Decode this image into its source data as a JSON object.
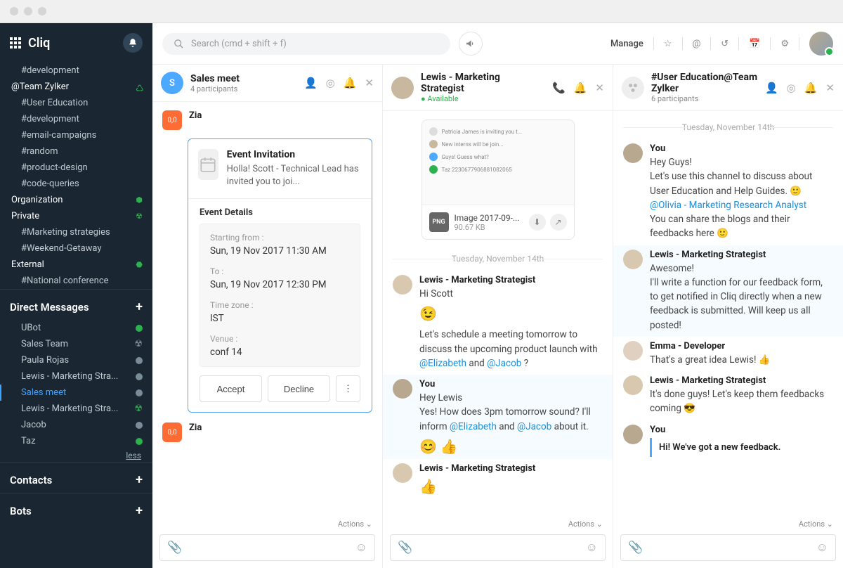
{
  "app": {
    "name": "Cliq"
  },
  "topbar": {
    "search_placeholder": "Search (cmd + shift + f)",
    "manage": "Manage"
  },
  "sidebar": {
    "channels_top": [
      "#development"
    ],
    "team": "@Team Zylker",
    "team_channels": [
      "#User Education",
      "#development",
      "#email-campaigns",
      "#random",
      "#product-design",
      "#code-queries"
    ],
    "org": "Organization",
    "private": "Private",
    "private_channels": [
      "#Marketing strategies",
      "#Weekend-Getaway"
    ],
    "external": "External",
    "external_channels": [
      "#National conference"
    ],
    "dm_header": "Direct Messages",
    "dms": [
      "UBot",
      "Sales Team",
      "Paula Rojas",
      "Lewis - Marketing Stra...",
      "Sales meet",
      "Lewis - Marketing Stra...",
      "Jacob",
      "Taz"
    ],
    "less": "less",
    "contacts_header": "Contacts",
    "bots_header": "Bots"
  },
  "panels": [
    {
      "title": "Sales meet",
      "subtitle": "4 participants",
      "avatar_letter": "S",
      "avatar_color": "#4da8ff",
      "zia": "Zia",
      "card": {
        "title": "Event Invitation",
        "desc": "Holla! Scott - Technical Lead has invited you to joi...",
        "section": "Event Details",
        "start_label": "Starting from :",
        "start_val": "Sun, 19 Nov 2017 11:30 AM",
        "to_label": "To :",
        "to_val": "Sun, 19 Nov 2017 12:30 PM",
        "tz_label": "Time zone :",
        "tz_val": "IST",
        "venue_label": "Venue :",
        "venue_val": "conf 14",
        "accept": "Accept",
        "decline": "Decline"
      },
      "actions": "Actions"
    },
    {
      "title": "Lewis - Marketing Strategist",
      "subtitle": "● Available",
      "file": {
        "name": "Image 2017-09-...",
        "size": "90.67 KB",
        "badge": "PNG"
      },
      "date": "Tuesday, November 14th",
      "m1_name": "Lewis - Marketing Strategist",
      "m1_text": "Hi Scott",
      "m1_text2a": "Let's schedule a meeting tomorrow to discuss the upcoming product launch with ",
      "m1_mention1": "@Elizabeth",
      "m1_and": " and ",
      "m1_mention2": "@Jacob",
      "m1_q": " ?",
      "m2_name": "You",
      "m2_text": "Hey Lewis",
      "m2_text2a": "Yes! How does 3pm tomorrow sound? I'll inform ",
      "m2_text2b": " about it.",
      "m3_name": "Lewis - Marketing Strategist",
      "actions": "Actions"
    },
    {
      "title": "#User Education@Team Zylker",
      "subtitle": "6 participants",
      "date": "Tuesday, November 14th",
      "m1_name": "You",
      "m1_a": "Hey Guys!",
      "m1_b": "Let's use this channel to discuss about User Education and Help Guides.  🙂",
      "m1_mention": "@Olivia - Marketing Research Analyst",
      "m1_c": "You can share the blogs and their feedbacks here 🙂",
      "m2_name": "Lewis - Marketing Strategist",
      "m2_a": "Awesome!",
      "m2_b": "I'll write a function for our feedback form, to get notified in Cliq directly when a new feedback is submitted. Will keep us all posted!",
      "m3_name": "Emma - Developer",
      "m3_a": "That's a great idea Lewis! 👍",
      "m4_name": "Lewis - Marketing Strategist",
      "m4_a": "It's done guys! Let's keep them feedbacks coming 😎",
      "m5_name": "You",
      "m5_quote": "Hi! We've got a new feedback.",
      "actions": "Actions"
    }
  ]
}
